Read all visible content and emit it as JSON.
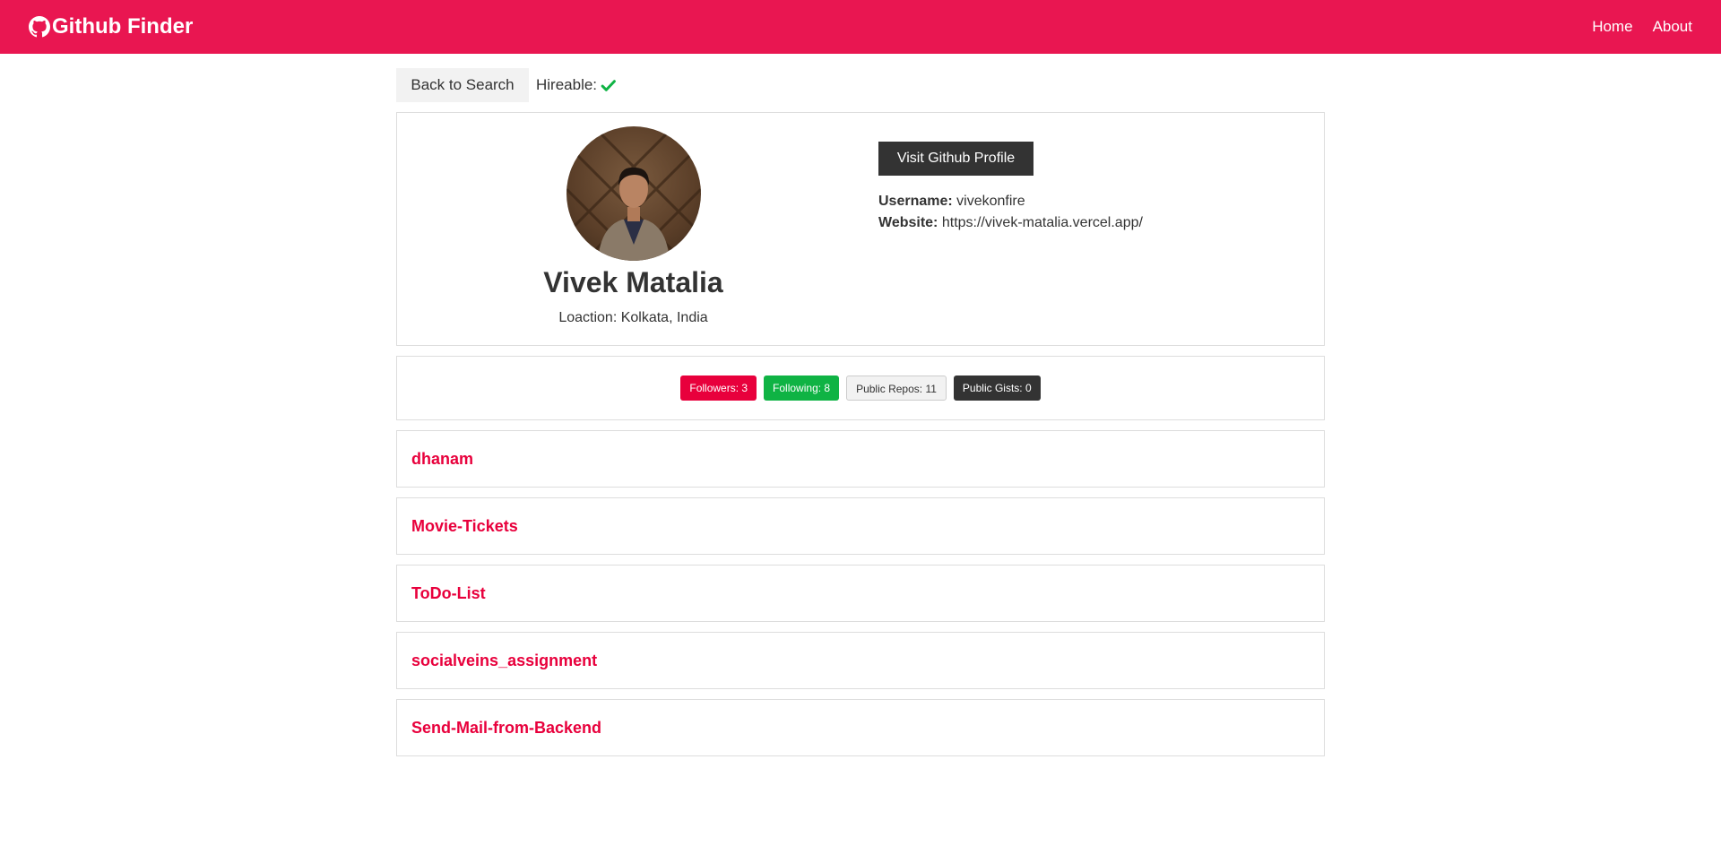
{
  "navbar": {
    "brand": "Github Finder",
    "brand_icon": "github-icon",
    "links": [
      {
        "label": "Home"
      },
      {
        "label": "About"
      }
    ],
    "color": "#e91651"
  },
  "top": {
    "back_label": "Back to Search",
    "hireable_label": "Hireable:",
    "hireable_icon": "check-icon",
    "hireable_color": "#0fb344"
  },
  "profile": {
    "name": "Vivek Matalia",
    "location": "Loaction: Kolkata, India",
    "visit_label": "Visit Github Profile",
    "username_label": "Username:",
    "username": "vivekonfire",
    "website_label": "Website:",
    "website": "https://vivek-matalia.vercel.app/"
  },
  "stats": [
    {
      "label": "Followers: 3",
      "style": "red"
    },
    {
      "label": "Following: 8",
      "style": "green"
    },
    {
      "label": "Public Repos: 11",
      "style": "light"
    },
    {
      "label": "Public Gists: 0",
      "style": "dark"
    }
  ],
  "repos": [
    {
      "name": "dhanam"
    },
    {
      "name": "Movie-Tickets"
    },
    {
      "name": "ToDo-List"
    },
    {
      "name": "socialveins_assignment"
    },
    {
      "name": "Send-Mail-from-Backend"
    }
  ]
}
